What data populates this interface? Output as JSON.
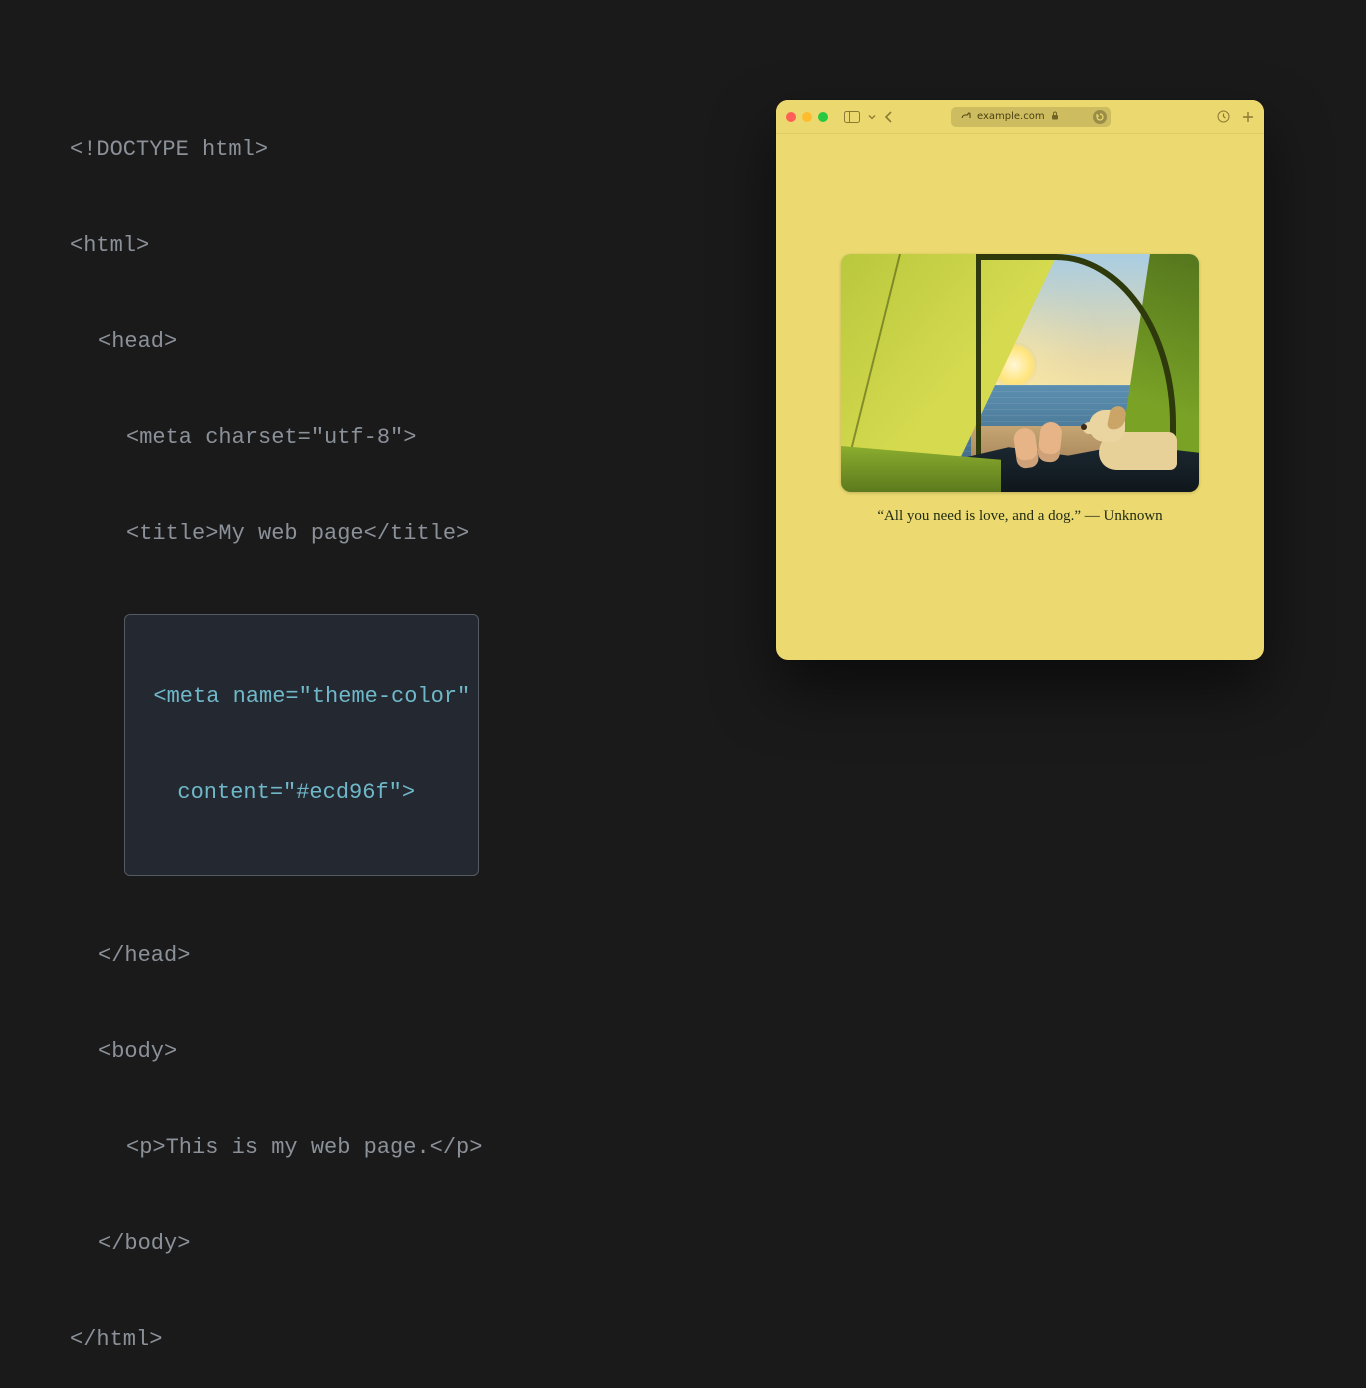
{
  "code": {
    "lines": {
      "l1": "<!DOCTYPE html>",
      "l2": "<html>",
      "l3": "<head>",
      "l4": "<meta charset=\"utf-8\">",
      "l5": "<title>My web page</title>",
      "hl1": "<meta name=\"theme-color\"",
      "hl2": "content=\"#ecd96f\">",
      "l6": "</head>",
      "l7": "<body>",
      "l8": "<p>This is my web page.</p>",
      "l9": "</body>",
      "l10": "</html>"
    }
  },
  "browser": {
    "address": "example.com",
    "theme_color": "#ecd96f",
    "caption": "“All you need is love, and a dog.” — Unknown"
  }
}
